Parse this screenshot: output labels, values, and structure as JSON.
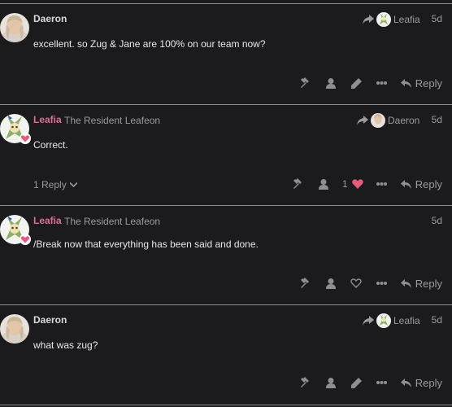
{
  "posts": [
    {
      "username": "Daeron",
      "reply_to_name": "Leafia",
      "age": "5d",
      "body": "excellent. so Zug & Jane are 100% on our team now?",
      "reply_label": "Reply"
    },
    {
      "username": "Leafia",
      "user_title": "The Resident Leafeon",
      "reply_to_name": "Daeron",
      "age": "5d",
      "body": "Correct.",
      "replies_label": "1 Reply",
      "like_count": "1",
      "reply_label": "Reply"
    },
    {
      "username": "Leafia",
      "user_title": "The Resident Leafeon",
      "age": "5d",
      "body": "/Break now that everything has been said and done.",
      "reply_label": "Reply"
    },
    {
      "username": "Daeron",
      "reply_to_name": "Leafia",
      "age": "5d",
      "body": "what was zug?",
      "reply_label": "Reply"
    }
  ],
  "colors": {
    "background": "#1b1b1d",
    "username_pink": "#e46b93",
    "heart": "#e45c7e",
    "muted": "#9b9b9b"
  }
}
